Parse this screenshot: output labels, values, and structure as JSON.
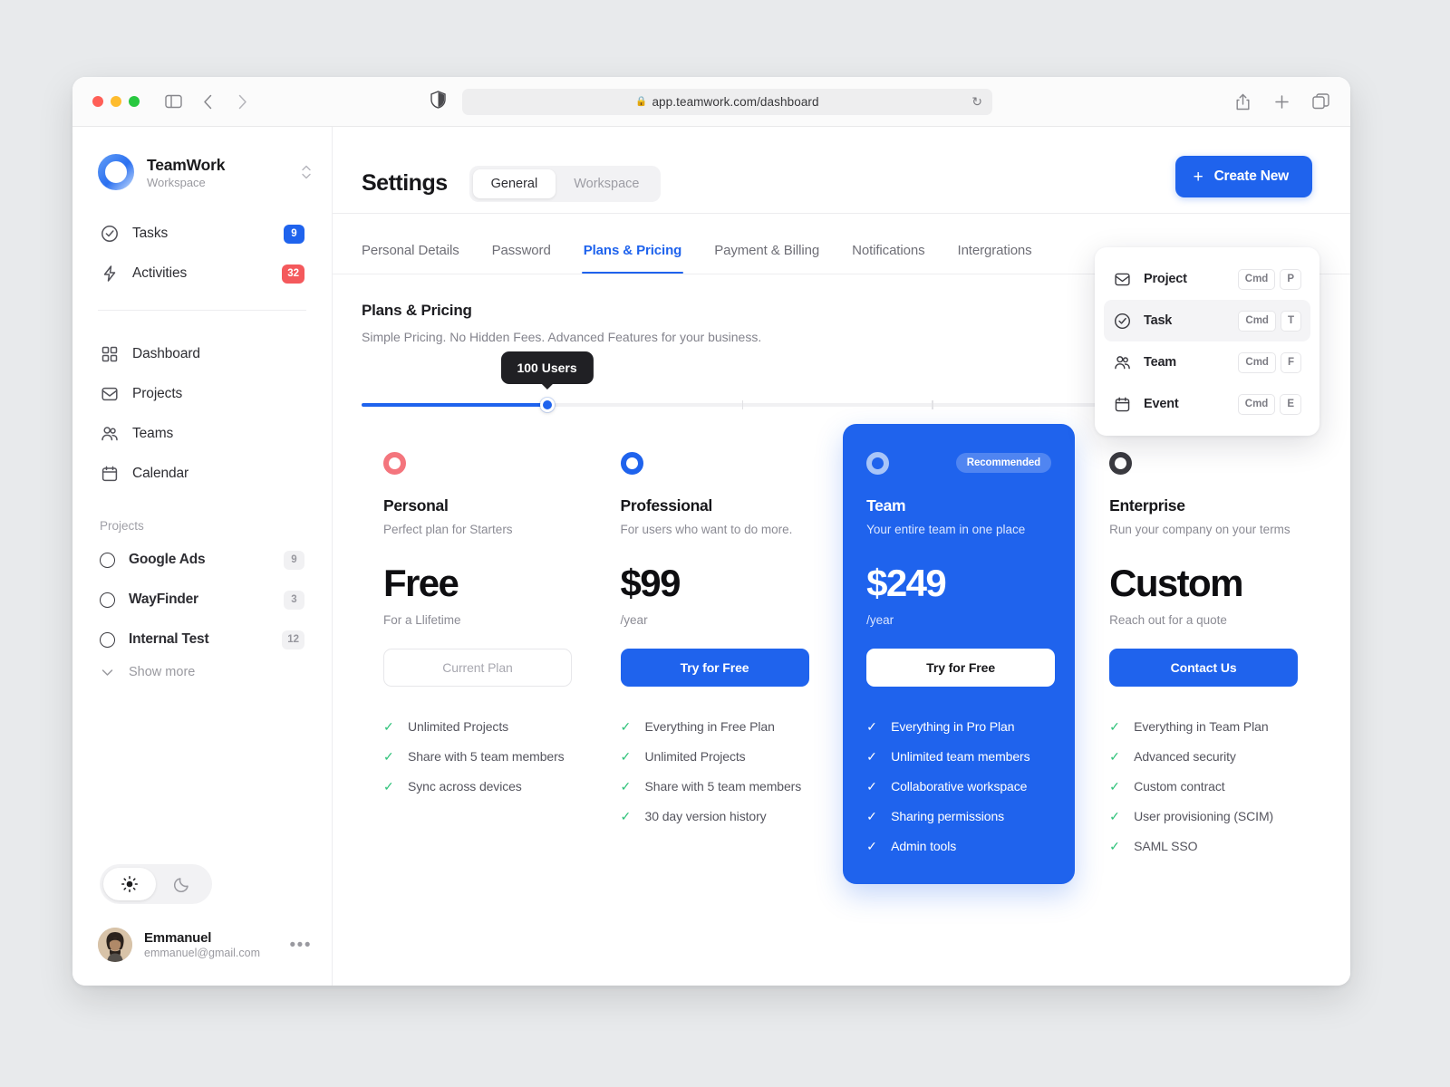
{
  "browser": {
    "url": "app.teamwork.com/dashboard",
    "lock": "lock-icon",
    "reload": "↻",
    "back": "‹",
    "forward": "›"
  },
  "sidebar": {
    "workspace": {
      "name": "TeamWork",
      "subtitle": "Workspace"
    },
    "nav": [
      {
        "label": "Tasks",
        "icon": "check-circle-icon",
        "badge": "9",
        "badge_color": "#1f63ed"
      },
      {
        "label": "Activities",
        "icon": "bolt-icon",
        "badge": "32",
        "badge_color": "#f4595c"
      }
    ],
    "nav2": [
      {
        "label": "Dashboard",
        "icon": "grid-icon"
      },
      {
        "label": "Projects",
        "icon": "inbox-icon"
      },
      {
        "label": "Teams",
        "icon": "users-icon"
      },
      {
        "label": "Calendar",
        "icon": "calendar-icon"
      }
    ],
    "projects_label": "Projects",
    "projects": [
      {
        "label": "Google Ads",
        "count": "9"
      },
      {
        "label": "WayFinder",
        "count": "3"
      },
      {
        "label": "Internal Test",
        "count": "12"
      }
    ],
    "show_more": "Show more",
    "theme": {
      "light": "sun-icon",
      "dark": "moon-icon",
      "active": "light"
    },
    "user": {
      "name": "Emmanuel",
      "email": "emmanuel@gmail.com",
      "menu": "•••"
    }
  },
  "header": {
    "title": "Settings",
    "segments": [
      {
        "label": "General",
        "active": true
      },
      {
        "label": "Workspace",
        "active": false
      }
    ],
    "create_button": "Create New",
    "plus": "+"
  },
  "dropdown": {
    "items": [
      {
        "label": "Project",
        "icon": "inbox-icon",
        "keys": [
          "Cmd",
          "P"
        ],
        "highlighted": false
      },
      {
        "label": "Task",
        "icon": "check-circle-icon",
        "keys": [
          "Cmd",
          "T"
        ],
        "highlighted": true
      },
      {
        "label": "Team",
        "icon": "users-icon",
        "keys": [
          "Cmd",
          "F"
        ],
        "highlighted": false
      },
      {
        "label": "Event",
        "icon": "calendar-icon",
        "keys": [
          "Cmd",
          "E"
        ],
        "highlighted": false
      }
    ]
  },
  "tabs": [
    {
      "label": "Personal Details",
      "active": false
    },
    {
      "label": "Password",
      "active": false
    },
    {
      "label": "Plans & Pricing",
      "active": true
    },
    {
      "label": "Payment & Billing",
      "active": false
    },
    {
      "label": "Notifications",
      "active": false
    },
    {
      "label": "Intergrations",
      "active": false
    }
  ],
  "section": {
    "title": "Plans & Pricing",
    "subtitle": "Simple Pricing. No Hidden Fees. Advanced Features for your business."
  },
  "slider": {
    "tooltip": "100 Users",
    "value_percent": 19.5,
    "accent": "#1f63ed"
  },
  "plans": [
    {
      "name": "Personal",
      "desc": "Perfect plan for Starters",
      "price": "Free",
      "period": "For a Llifetime",
      "cta": "Current Plan",
      "icon_color": "#f4757d",
      "features": [
        "Unlimited Projects",
        "Share with 5 team members",
        "Sync across devices"
      ]
    },
    {
      "name": "Professional",
      "desc": "For users who want to do more.",
      "price": "$99",
      "period": "/year",
      "cta": "Try for Free",
      "icon_color": "#1f63ed",
      "features": [
        "Everything in Free Plan",
        "Unlimited Projects",
        "Share with 5 team members",
        "30 day version history"
      ]
    },
    {
      "name": "Team",
      "desc": "Your entire team in one place",
      "price": "$249",
      "period": "/year",
      "cta": "Try for Free",
      "badge": "Recommended",
      "icon_color": "#a8c5f8",
      "features": [
        "Everything in Pro Plan",
        "Unlimited team members",
        "Collaborative workspace",
        "Sharing permissions",
        "Admin tools"
      ]
    },
    {
      "name": "Enterprise",
      "desc": "Run your company on your terms",
      "price": "Custom",
      "period": "Reach out for a quote",
      "cta": "Contact Us",
      "icon_color": "#3a3a40",
      "features": [
        "Everything in Team Plan",
        "Advanced security",
        "Custom contract",
        "User provisioning (SCIM)",
        "SAML SSO"
      ]
    }
  ]
}
